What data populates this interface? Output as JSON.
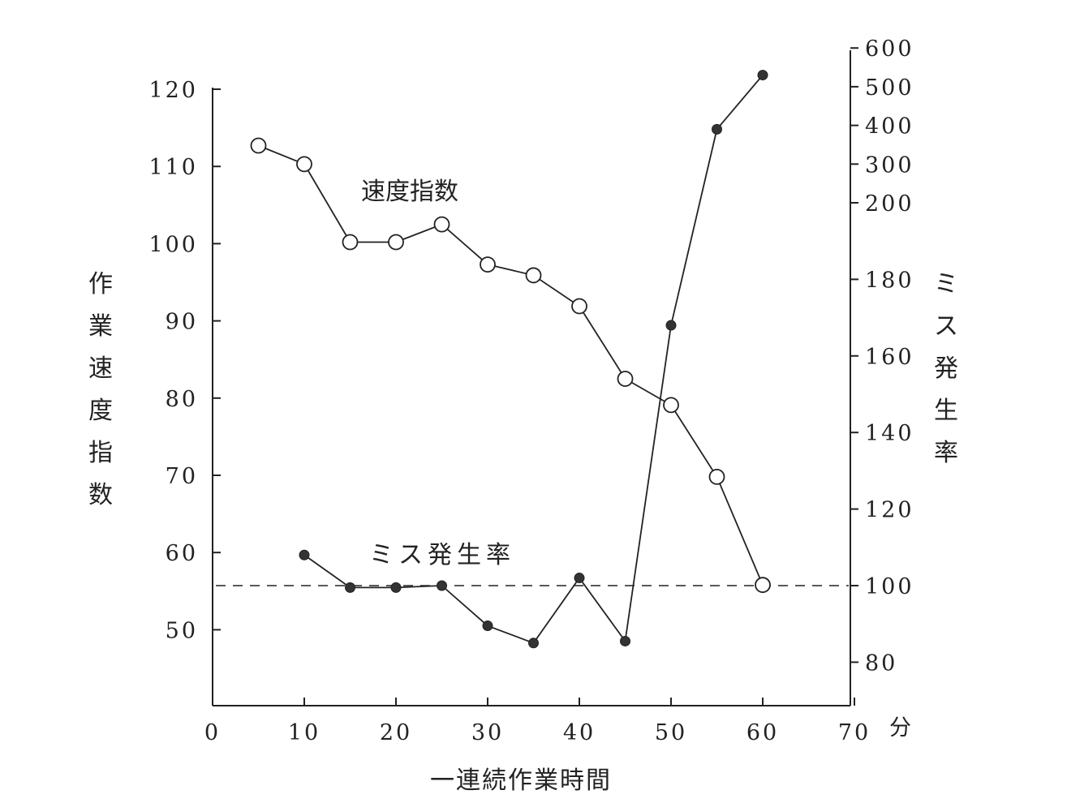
{
  "chart_data": {
    "type": "line",
    "x_unit": "分",
    "xlabel": "一連続作業時間",
    "ylabel_left": "作業速度指数",
    "ylabel_right": "ミス発生率",
    "x_ticks": [
      0,
      10,
      20,
      30,
      40,
      50,
      60,
      70
    ],
    "xlim": [
      0,
      70
    ],
    "y_left_ticks": [
      50,
      60,
      70,
      80,
      90,
      100,
      110,
      120
    ],
    "y_left_lim": [
      40,
      121
    ],
    "y_right_ticks_linear": [
      80,
      100,
      120,
      140,
      160,
      180
    ],
    "y_right_ticks_compressed": [
      200,
      300,
      400,
      500,
      600
    ],
    "reference_line": {
      "axis": "right",
      "value": 100,
      "style": "dashed"
    },
    "series": [
      {
        "name": "速度指数",
        "axis": "left",
        "marker": "open-circle",
        "x": [
          5,
          10,
          15,
          20,
          25,
          30,
          35,
          40,
          45,
          50,
          55,
          60
        ],
        "values": [
          112.7,
          110.3,
          100.2,
          100.2,
          102.5,
          97.3,
          95.9,
          91.9,
          82.5,
          79.1,
          69.8,
          55.8
        ]
      },
      {
        "name": "ミス発生率",
        "axis": "right",
        "marker": "filled-circle",
        "x": [
          10,
          15,
          20,
          25,
          30,
          35,
          40,
          45,
          50,
          55,
          60
        ],
        "values": [
          108,
          99.5,
          99.5,
          100,
          89.5,
          85,
          102,
          85.5,
          168,
          390,
          530
        ]
      }
    ]
  }
}
